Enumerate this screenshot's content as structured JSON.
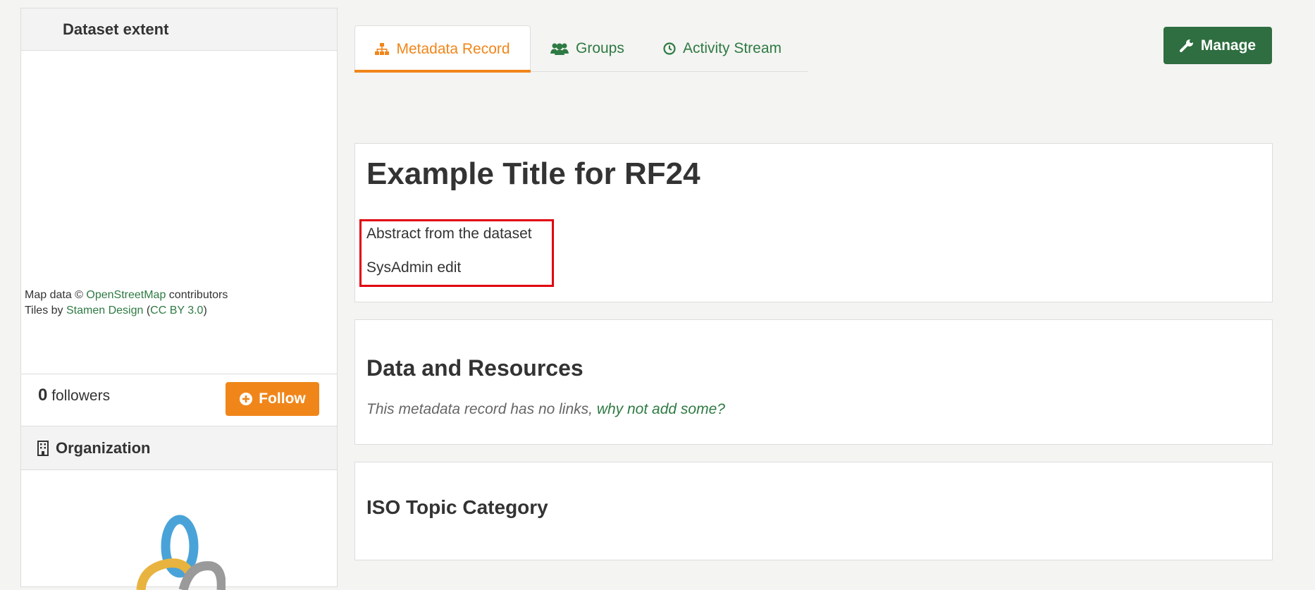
{
  "sidebar": {
    "extent_heading": "Dataset extent",
    "attribution": {
      "line1_prefix": "Map data © ",
      "line1_link": "OpenStreetMap",
      "line1_suffix": " contributors",
      "line2_prefix": "Tiles by ",
      "line2_link1": "Stamen Design",
      "line2_mid": " (",
      "line2_link2": "CC BY 3.0",
      "line2_suffix": ")"
    },
    "followers": {
      "count": "0",
      "label": "followers",
      "follow_button": "Follow"
    },
    "organization_heading": "Organization"
  },
  "tabs": [
    {
      "label": "Metadata Record",
      "icon": "sitemap-icon",
      "active": true
    },
    {
      "label": "Groups",
      "icon": "users-icon",
      "active": false
    },
    {
      "label": "Activity Stream",
      "icon": "clock-icon",
      "active": false
    }
  ],
  "manage_button": "Manage",
  "dataset": {
    "title": "Example Title for RF24",
    "notes": [
      "Abstract from the dataset",
      "SysAdmin edit"
    ]
  },
  "resources": {
    "heading": "Data and Resources",
    "empty_text": "This metadata record has no links, ",
    "empty_link": "why not add some?"
  },
  "iso": {
    "heading": "ISO Topic Category"
  },
  "colors": {
    "accent_orange": "#f0861a",
    "brand_green": "#2e6e40",
    "link_green": "#2e7a43",
    "highlight_red": "#e0000f"
  }
}
